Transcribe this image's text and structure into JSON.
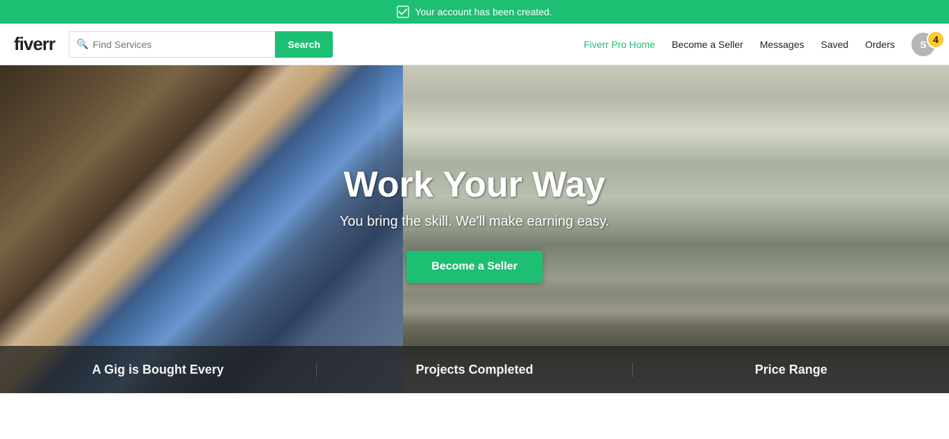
{
  "notification": {
    "message": "Your account has been created.",
    "icon": "✓"
  },
  "header": {
    "logo": "fiverr",
    "search": {
      "placeholder": "Find Services",
      "button_label": "Search"
    },
    "nav": {
      "fiverr_pro": "Fiverr Pro Home",
      "become_seller": "Become a Seller",
      "messages": "Messages",
      "saved": "Saved",
      "orders": "Orders"
    },
    "user": {
      "initial": "S",
      "notification_count": "4"
    }
  },
  "hero": {
    "title": "Work Your Way",
    "subtitle": "You bring the skill. We'll make earning easy.",
    "cta_button": "Become a Seller"
  },
  "stats": [
    {
      "label": "A Gig is Bought Every"
    },
    {
      "label": "Projects Completed"
    },
    {
      "label": "Price Range"
    }
  ]
}
